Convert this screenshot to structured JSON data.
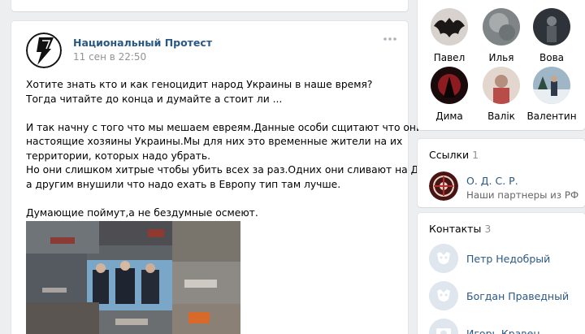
{
  "post": {
    "author": "Национальный Протест",
    "date": "11 сен в 22:50",
    "lines": [
      "Хотите знать кто и как геноцидит народ Украины в наше время?",
      "Тогда читайте до конца и думайте а стоит ли ...",
      "",
      "И так начну с того что мы мешаем евреям.Данные особи сщитают что они",
      "настоящие хозяины Украины.Мы для них это временные жители на их",
      "территории, которых надо убрать.",
      "Но они слишком хитрые чтобы убить всех за раз.Одних они сливают на Донбассе",
      "а другим внушили что надо ехать в Европу тип там лучше.",
      "",
      "Думающие поймут,а не бездумные осмеют."
    ]
  },
  "friends": [
    {
      "name": "Павел",
      "color": "#c9c2bd"
    },
    {
      "name": "Илья",
      "color": "#8f9596"
    },
    {
      "name": "Вова",
      "color": "#3b4248"
    },
    {
      "name": "Дима",
      "color": "#2a0d0f"
    },
    {
      "name": "Валік",
      "color": "#d7c8c0"
    },
    {
      "name": "Валентин",
      "color": "#3f5a6e"
    }
  ],
  "links": {
    "title": "Ссылки",
    "count": "1",
    "items": [
      {
        "name": "О. Д. С. Р.",
        "desc": "Наши партнеры из РФ"
      }
    ]
  },
  "contacts": {
    "title": "Контакты",
    "count": "3",
    "items": [
      {
        "name": "Петр Недобрый"
      },
      {
        "name": "Богдан Праведный"
      },
      {
        "name": "Игорь Кравец"
      }
    ]
  },
  "colors": {
    "link": "#2a5885",
    "background": "#edeef0"
  }
}
